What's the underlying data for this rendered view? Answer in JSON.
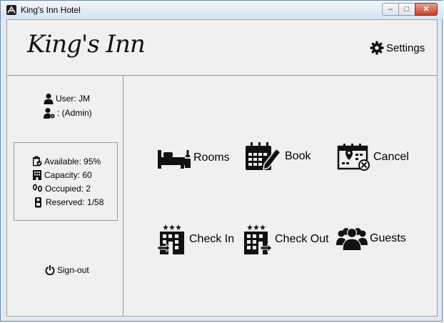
{
  "window": {
    "title": "King's Inn Hotel",
    "min_glyph": "–",
    "max_glyph": "□",
    "close_glyph": "✕"
  },
  "header": {
    "logo_text": "King's Inn",
    "settings_label": "Settings",
    "settings_icon": "gear-icon"
  },
  "sidebar": {
    "user_label": "User: JM",
    "role_label": ": (Admin)",
    "stats": {
      "available": "Available: 95%",
      "capacity": "Capacity: 60",
      "occupied": "Occupied: 2",
      "reserved": "Reserved: 1/58"
    },
    "signout_label": "Sign-out"
  },
  "tiles": {
    "rooms": "Rooms",
    "book": "Book",
    "cancel": "Cancel",
    "checkin": "Check In",
    "checkout": "Check Out",
    "guests": "Guests"
  }
}
